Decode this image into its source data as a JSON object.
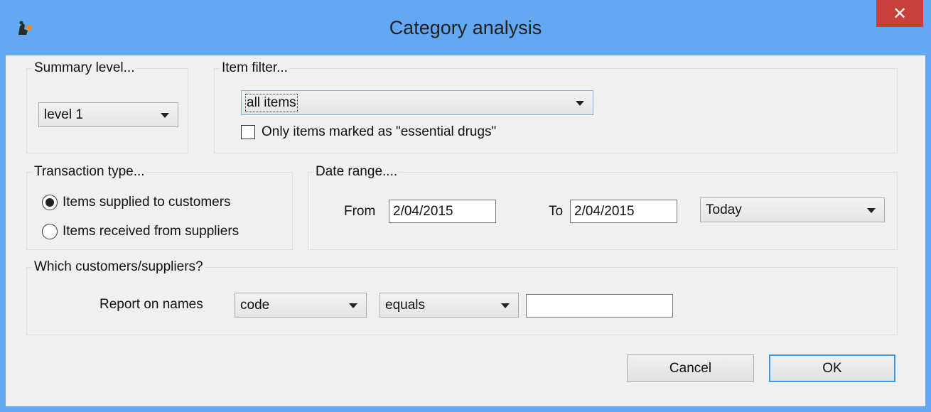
{
  "window": {
    "title": "Category analysis",
    "close_icon": "close-icon",
    "app_icon": "msupply-app-icon"
  },
  "summary": {
    "legend": "Summary level...",
    "value": "level 1"
  },
  "item_filter": {
    "legend": "Item filter...",
    "value": "all items",
    "essential_label": "Only items marked as \"essential drugs\"",
    "essential_checked": false
  },
  "transaction": {
    "legend": "Transaction type...",
    "options": [
      "Items supplied to customers",
      "Items received from suppliers"
    ],
    "selected_index": 0
  },
  "date_range": {
    "legend": "Date range....",
    "from_label": "From",
    "from_value": "2/04/2015",
    "to_label": "To",
    "to_value": "2/04/2015",
    "preset": "Today"
  },
  "names": {
    "legend": "Which customers/suppliers?",
    "report_label": "Report on names",
    "field": "code",
    "operator": "equals",
    "value": ""
  },
  "buttons": {
    "cancel": "Cancel",
    "ok": "OK"
  },
  "colors": {
    "titlebar": "#62a8f2",
    "close": "#c7403a",
    "dialog_bg": "#f0f0f0",
    "default_button_border": "#3c9be6"
  }
}
